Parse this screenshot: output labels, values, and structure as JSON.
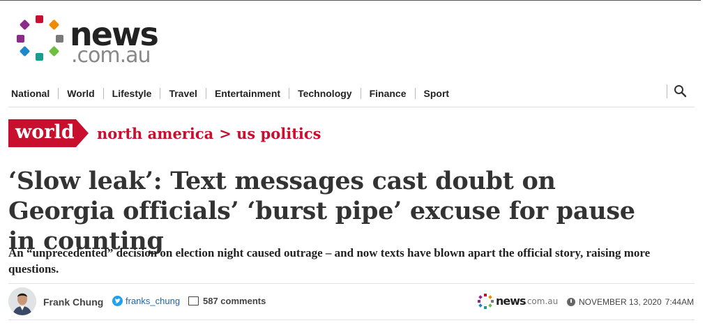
{
  "brand": {
    "wordmark": "news",
    "domain_suffix": ".com.au",
    "dot_colors": [
      "#c8102e",
      "#f08a00",
      "#8c2b8a",
      "#7a7a7a",
      "#1e88c9",
      "#1a9e8f",
      "#6fbe3f"
    ]
  },
  "nav": {
    "items": [
      "National",
      "World",
      "Lifestyle",
      "Travel",
      "Entertainment",
      "Technology",
      "Finance",
      "Sport"
    ],
    "search_icon": "search-icon"
  },
  "section": {
    "badge": "world",
    "crumbs": [
      "north america",
      "> us politics"
    ],
    "accent": "#c8102e"
  },
  "article": {
    "headline": "‘Slow leak’: Text messages cast doubt on Georgia officials’ ‘burst pipe’ excuse for pause in counting",
    "standfirst": "An “unprecedented” decision on election night caused outrage – and now texts have blown apart the official story, raising more questions."
  },
  "byline": {
    "author": "Frank Chung",
    "twitter_handle": "franks_chung",
    "comments": "587 comments",
    "date": "NOVEMBER 13, 2020",
    "time": "7:44AM"
  }
}
